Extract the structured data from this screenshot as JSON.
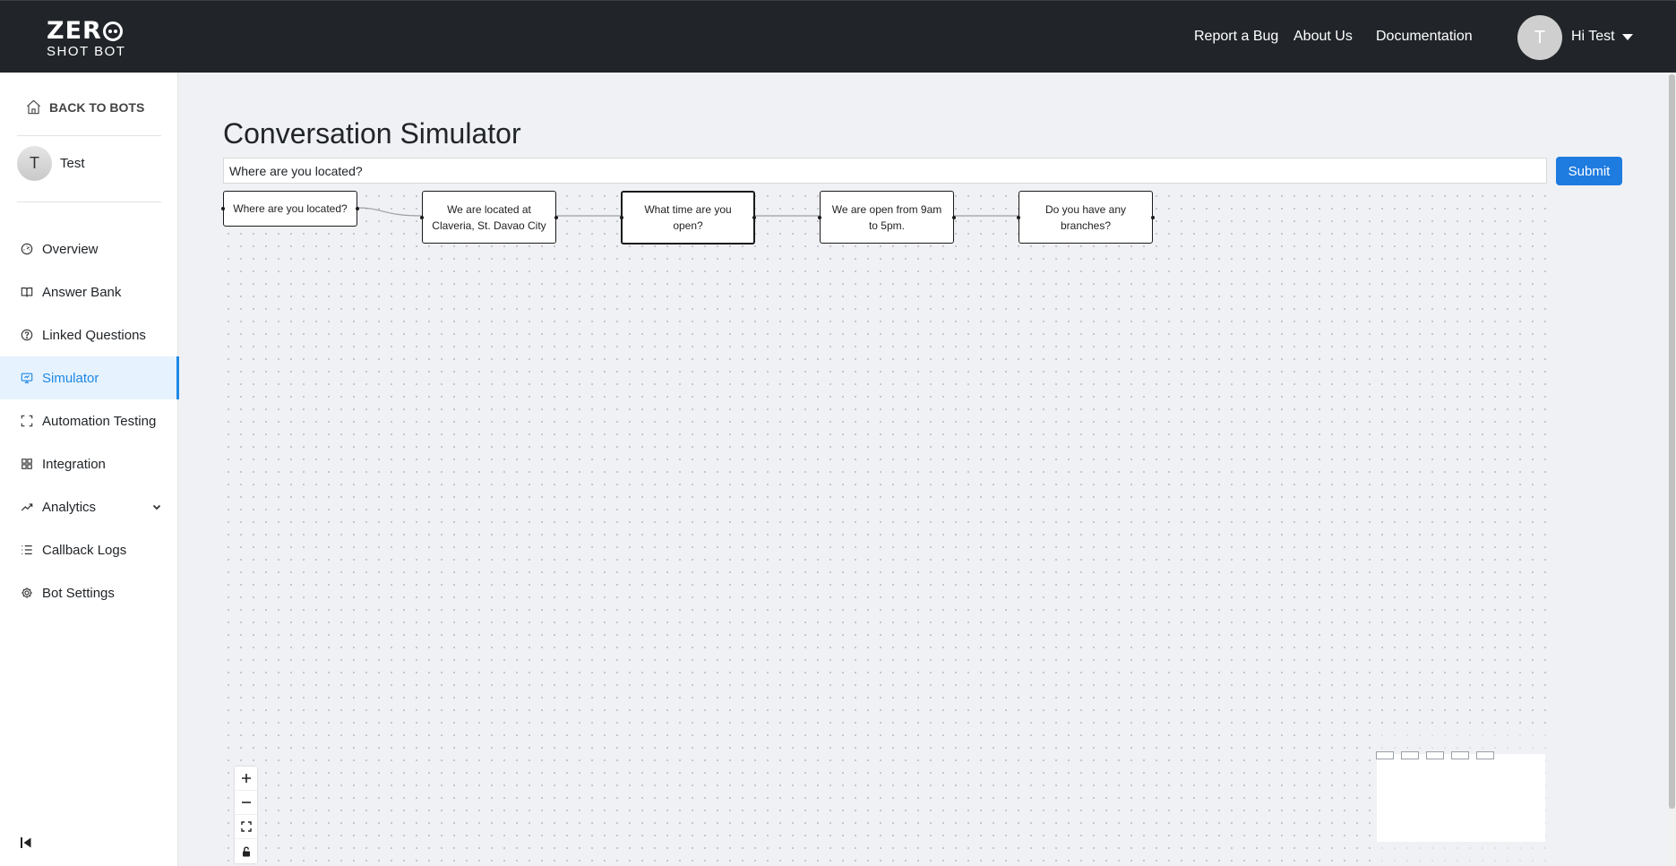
{
  "header": {
    "logo_line1": "ZER",
    "logo_line2": "SHOT BOT",
    "nav": [
      "Report a Bug",
      "About Us",
      "Documentation"
    ],
    "avatar_letter": "T",
    "user_greeting": "Hi Test"
  },
  "sidebar": {
    "back_label": "BACK TO BOTS",
    "bot_avatar_letter": "T",
    "bot_name": "Test",
    "items": [
      {
        "label": "Overview",
        "icon": "gauge-icon"
      },
      {
        "label": "Answer Bank",
        "icon": "book-icon"
      },
      {
        "label": "Linked Questions",
        "icon": "question-circle-icon"
      },
      {
        "label": "Simulator",
        "icon": "monitor-icon",
        "active": true
      },
      {
        "label": "Automation Testing",
        "icon": "scan-icon"
      },
      {
        "label": "Integration",
        "icon": "grid-icon"
      },
      {
        "label": "Analytics",
        "icon": "trend-icon",
        "expandable": true
      },
      {
        "label": "Callback Logs",
        "icon": "list-icon"
      },
      {
        "label": "Bot Settings",
        "icon": "gear-icon"
      }
    ]
  },
  "main": {
    "title": "Conversation Simulator",
    "question_value": "Where are you located?",
    "submit_label": "Submit"
  },
  "flow": {
    "nodes": [
      {
        "line1": "Where are you located?",
        "line2": ""
      },
      {
        "line1": "We are located at",
        "line2": "Claveria, St. Davao City"
      },
      {
        "line1": "What time are you",
        "line2": "open?"
      },
      {
        "line1": "We are open from 9am",
        "line2": "to 5pm."
      },
      {
        "line1": "Do you have any",
        "line2": "branches?"
      }
    ]
  }
}
